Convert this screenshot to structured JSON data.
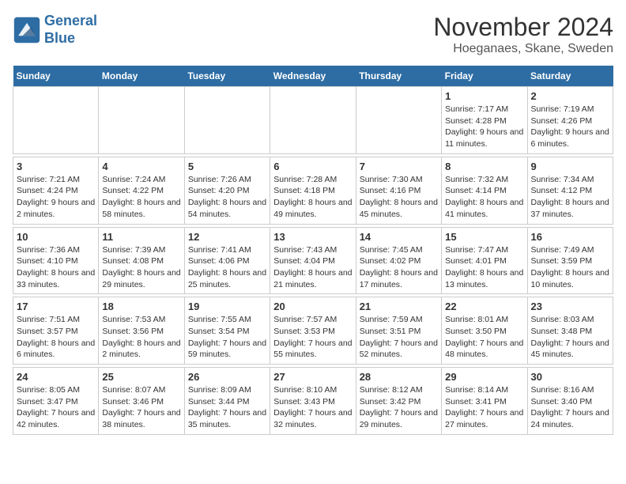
{
  "header": {
    "logo_line1": "General",
    "logo_line2": "Blue",
    "title": "November 2024",
    "subtitle": "Hoeganaes, Skane, Sweden"
  },
  "days_of_week": [
    "Sunday",
    "Monday",
    "Tuesday",
    "Wednesday",
    "Thursday",
    "Friday",
    "Saturday"
  ],
  "weeks": [
    {
      "days": [
        {
          "num": "",
          "info": ""
        },
        {
          "num": "",
          "info": ""
        },
        {
          "num": "",
          "info": ""
        },
        {
          "num": "",
          "info": ""
        },
        {
          "num": "",
          "info": ""
        },
        {
          "num": "1",
          "info": "Sunrise: 7:17 AM\nSunset: 4:28 PM\nDaylight: 9 hours and 11 minutes."
        },
        {
          "num": "2",
          "info": "Sunrise: 7:19 AM\nSunset: 4:26 PM\nDaylight: 9 hours and 6 minutes."
        }
      ]
    },
    {
      "days": [
        {
          "num": "3",
          "info": "Sunrise: 7:21 AM\nSunset: 4:24 PM\nDaylight: 9 hours and 2 minutes."
        },
        {
          "num": "4",
          "info": "Sunrise: 7:24 AM\nSunset: 4:22 PM\nDaylight: 8 hours and 58 minutes."
        },
        {
          "num": "5",
          "info": "Sunrise: 7:26 AM\nSunset: 4:20 PM\nDaylight: 8 hours and 54 minutes."
        },
        {
          "num": "6",
          "info": "Sunrise: 7:28 AM\nSunset: 4:18 PM\nDaylight: 8 hours and 49 minutes."
        },
        {
          "num": "7",
          "info": "Sunrise: 7:30 AM\nSunset: 4:16 PM\nDaylight: 8 hours and 45 minutes."
        },
        {
          "num": "8",
          "info": "Sunrise: 7:32 AM\nSunset: 4:14 PM\nDaylight: 8 hours and 41 minutes."
        },
        {
          "num": "9",
          "info": "Sunrise: 7:34 AM\nSunset: 4:12 PM\nDaylight: 8 hours and 37 minutes."
        }
      ]
    },
    {
      "days": [
        {
          "num": "10",
          "info": "Sunrise: 7:36 AM\nSunset: 4:10 PM\nDaylight: 8 hours and 33 minutes."
        },
        {
          "num": "11",
          "info": "Sunrise: 7:39 AM\nSunset: 4:08 PM\nDaylight: 8 hours and 29 minutes."
        },
        {
          "num": "12",
          "info": "Sunrise: 7:41 AM\nSunset: 4:06 PM\nDaylight: 8 hours and 25 minutes."
        },
        {
          "num": "13",
          "info": "Sunrise: 7:43 AM\nSunset: 4:04 PM\nDaylight: 8 hours and 21 minutes."
        },
        {
          "num": "14",
          "info": "Sunrise: 7:45 AM\nSunset: 4:02 PM\nDaylight: 8 hours and 17 minutes."
        },
        {
          "num": "15",
          "info": "Sunrise: 7:47 AM\nSunset: 4:01 PM\nDaylight: 8 hours and 13 minutes."
        },
        {
          "num": "16",
          "info": "Sunrise: 7:49 AM\nSunset: 3:59 PM\nDaylight: 8 hours and 10 minutes."
        }
      ]
    },
    {
      "days": [
        {
          "num": "17",
          "info": "Sunrise: 7:51 AM\nSunset: 3:57 PM\nDaylight: 8 hours and 6 minutes."
        },
        {
          "num": "18",
          "info": "Sunrise: 7:53 AM\nSunset: 3:56 PM\nDaylight: 8 hours and 2 minutes."
        },
        {
          "num": "19",
          "info": "Sunrise: 7:55 AM\nSunset: 3:54 PM\nDaylight: 7 hours and 59 minutes."
        },
        {
          "num": "20",
          "info": "Sunrise: 7:57 AM\nSunset: 3:53 PM\nDaylight: 7 hours and 55 minutes."
        },
        {
          "num": "21",
          "info": "Sunrise: 7:59 AM\nSunset: 3:51 PM\nDaylight: 7 hours and 52 minutes."
        },
        {
          "num": "22",
          "info": "Sunrise: 8:01 AM\nSunset: 3:50 PM\nDaylight: 7 hours and 48 minutes."
        },
        {
          "num": "23",
          "info": "Sunrise: 8:03 AM\nSunset: 3:48 PM\nDaylight: 7 hours and 45 minutes."
        }
      ]
    },
    {
      "days": [
        {
          "num": "24",
          "info": "Sunrise: 8:05 AM\nSunset: 3:47 PM\nDaylight: 7 hours and 42 minutes."
        },
        {
          "num": "25",
          "info": "Sunrise: 8:07 AM\nSunset: 3:46 PM\nDaylight: 7 hours and 38 minutes."
        },
        {
          "num": "26",
          "info": "Sunrise: 8:09 AM\nSunset: 3:44 PM\nDaylight: 7 hours and 35 minutes."
        },
        {
          "num": "27",
          "info": "Sunrise: 8:10 AM\nSunset: 3:43 PM\nDaylight: 7 hours and 32 minutes."
        },
        {
          "num": "28",
          "info": "Sunrise: 8:12 AM\nSunset: 3:42 PM\nDaylight: 7 hours and 29 minutes."
        },
        {
          "num": "29",
          "info": "Sunrise: 8:14 AM\nSunset: 3:41 PM\nDaylight: 7 hours and 27 minutes."
        },
        {
          "num": "30",
          "info": "Sunrise: 8:16 AM\nSunset: 3:40 PM\nDaylight: 7 hours and 24 minutes."
        }
      ]
    }
  ]
}
